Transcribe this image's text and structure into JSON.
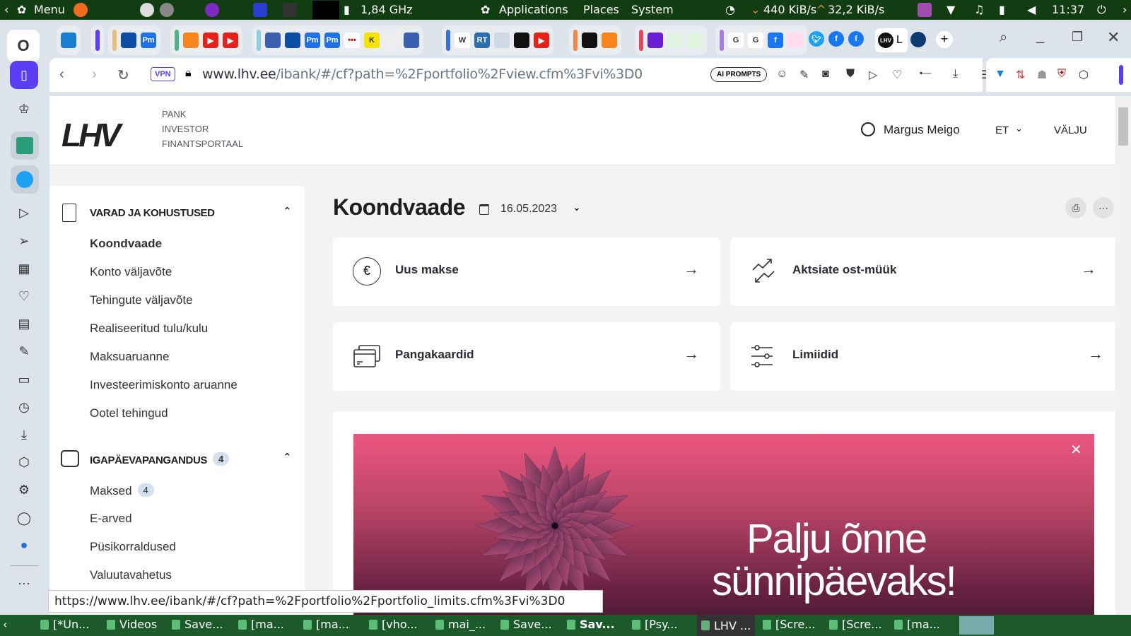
{
  "panel": {
    "menu": "Menu",
    "cpu": "1,84 GHz",
    "applications": "Applications",
    "places": "Places",
    "system": "System",
    "net_down": "440 KiB/s",
    "net_up": "32,2 KiB/s",
    "clock": "11:37"
  },
  "tabs": {
    "groups": [
      {
        "accent": "#3b82f6",
        "items": [
          "vivaldi"
        ]
      },
      {
        "accent": "#5b3df5",
        "items": []
      },
      {
        "accent": "#e8c07a",
        "items": [
          "err",
          "Pm"
        ]
      },
      {
        "accent": "#4cb38a",
        "items": [
          "metamask",
          "youtube",
          "youtube"
        ]
      },
      {
        "accent": "#8ccfe0",
        "items": [
          "flag",
          "err",
          "Pm",
          "Pm",
          "flickr",
          "K",
          "dots",
          "flag"
        ]
      },
      {
        "accent": "#3b6fe0",
        "items": [
          "W",
          "RT",
          "doc",
          "archive",
          "youtube"
        ]
      },
      {
        "accent": "#f08a4b",
        "items": [
          "archive",
          "metamask"
        ]
      },
      {
        "accent": "#e24a5e",
        "items": [
          "mail",
          "blank",
          "blank"
        ]
      },
      {
        "accent": "#a77be0",
        "items": [
          "G",
          "G",
          "facebook",
          "radio"
        ]
      }
    ],
    "loose": [
      "twitter",
      "facebook",
      "facebook"
    ],
    "active_tab": {
      "icon": "LHV",
      "label": "L"
    },
    "new_tab": "+"
  },
  "address": {
    "vpn": "VPN",
    "url_host": "www.lhv.ee",
    "url_path": "/ibank/#/cf?path=%2Fportfolio%2Fview.cfm%3Fvi%3D0",
    "ai_prompts": "AI PROMPTS"
  },
  "header": {
    "logo": "LHV",
    "sub": [
      "PANK",
      "INVESTOR",
      "FINANTSPORTAAL"
    ],
    "user": "Margus Meigo",
    "lang": "ET",
    "logout": "VÄLJU"
  },
  "sidebar": {
    "sections": [
      {
        "title": "VARAD JA KOHUSTUSED",
        "items": [
          "Koondvaade",
          "Konto väljavõte",
          "Tehingute väljavõte",
          "Realiseeritud tulu/kulu",
          "Maksuaruanne",
          "Investeerimiskonto aruanne",
          "Ootel tehingud"
        ]
      },
      {
        "title": "IGAPÄEVAPANGANDUS",
        "badge": "4",
        "items": [
          "Maksed",
          "E-arved",
          "Püsikorraldused",
          "Valuutavahetus"
        ],
        "maksed_badge": "4"
      }
    ]
  },
  "main": {
    "title": "Koondvaade",
    "date": "16.05.2023",
    "cards": [
      "Uus makse",
      "Aktsiate ost-müük",
      "Pangakaardid",
      "Limiidid"
    ],
    "banner": {
      "line1": "Palju õnne",
      "line2": "sünnipäevaks!"
    }
  },
  "status_url": "https://www.lhv.ee/ibank/#/cf?path=%2Fportfolio%2Fportfolio_limits.cfm%3Fvi%3D0",
  "taskbar": [
    "[*Un...",
    "Videos",
    "Save...",
    "[ma...",
    "[ma...",
    "[vho...",
    "mai_...",
    "Save...",
    "Sav...",
    "[Psy...",
    "LHV ...",
    "[Scre...",
    "[Scre...",
    "[ma..."
  ]
}
